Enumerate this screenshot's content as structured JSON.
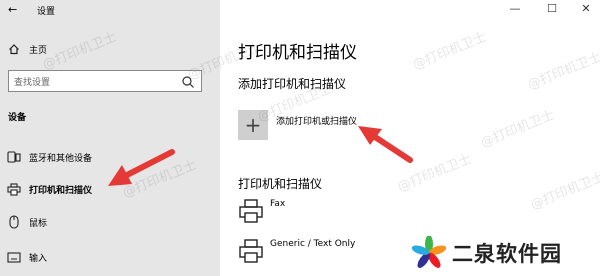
{
  "window": {
    "title": "设置",
    "back_icon": "←",
    "controls": {
      "minimize": "—",
      "maximize": "☐",
      "close": "✕"
    }
  },
  "sidebar": {
    "home_label": "主页",
    "search_placeholder": "查找设置",
    "section_label": "设备",
    "items": [
      {
        "label": "蓝牙和其他设备",
        "icon": "bluetooth-devices-icon"
      },
      {
        "label": "打印机和扫描仪",
        "icon": "printer-icon",
        "active": true
      },
      {
        "label": "鼠标",
        "icon": "mouse-icon"
      },
      {
        "label": "输入",
        "icon": "keyboard-icon"
      }
    ]
  },
  "main": {
    "page_title": "打印机和扫描仪",
    "add_section_title": "添加打印机和扫描仪",
    "add_button_symbol": "+",
    "add_button_label": "添加打印机或扫描仪",
    "printers_section_title": "打印机和扫描仪",
    "printers": [
      {
        "name": "Fax"
      },
      {
        "name": "Generic / Text Only"
      }
    ]
  },
  "watermark": {
    "text": "@打印机卫士"
  },
  "brand": {
    "text": "二泉软件园"
  },
  "colors": {
    "sidebar_bg": "#e6e6e6",
    "arrow_red": "#e53935",
    "add_box_bg": "#cfcfcf"
  }
}
